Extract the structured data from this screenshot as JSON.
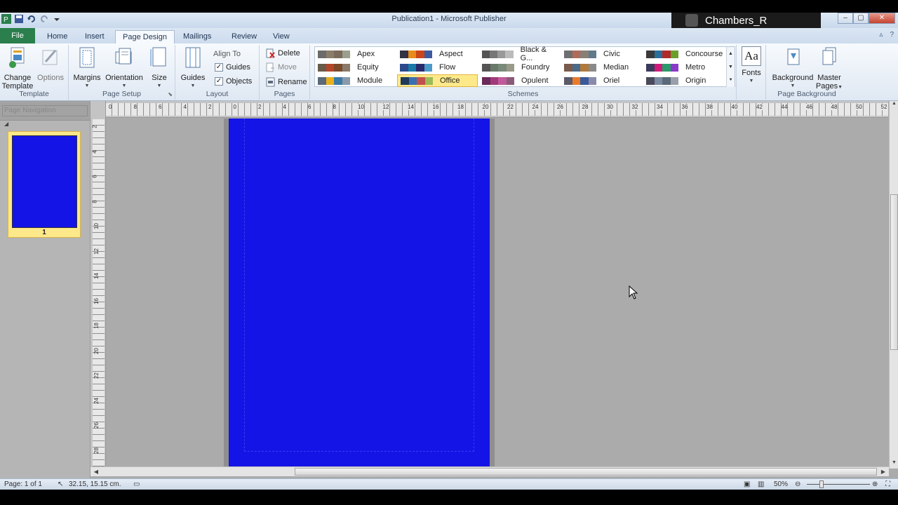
{
  "window": {
    "title": "Publication1 - Microsoft Publisher",
    "user": "Chambers_R"
  },
  "tabs": [
    {
      "label": "File"
    },
    {
      "label": "Home"
    },
    {
      "label": "Insert"
    },
    {
      "label": "Page Design"
    },
    {
      "label": "Mailings"
    },
    {
      "label": "Review"
    },
    {
      "label": "View"
    }
  ],
  "active_tab": "Page Design",
  "ribbon": {
    "template": {
      "group": "Template",
      "change_template": "Change Template",
      "change_template_l1": "Change",
      "change_template_l2": "Template",
      "options": "Options"
    },
    "page_setup": {
      "group": "Page Setup",
      "margins": "Margins",
      "orientation": "Orientation",
      "size": "Size"
    },
    "layout": {
      "group": "Layout",
      "guides": "Guides",
      "align_to": "Align To",
      "align_guides": "Guides",
      "align_objects": "Objects"
    },
    "pages": {
      "group": "Pages",
      "delete": "Delete",
      "move": "Move",
      "rename": "Rename"
    },
    "schemes": {
      "group": "Schemes",
      "items": [
        {
          "name": "Apex",
          "colors": [
            "#6b6b6b",
            "#8a7d6a",
            "#7a6b5a",
            "#9aa08b"
          ]
        },
        {
          "name": "Aspect",
          "colors": [
            "#333344",
            "#e88a1c",
            "#c9451c",
            "#3b5aa0"
          ]
        },
        {
          "name": "Black & G...",
          "colors": [
            "#555555",
            "#777777",
            "#999999",
            "#bbbbbb"
          ]
        },
        {
          "name": "Civic",
          "colors": [
            "#6f6f6f",
            "#b06a5a",
            "#8a7f75",
            "#5f7a8a"
          ]
        },
        {
          "name": "Concourse",
          "colors": [
            "#3a3a3a",
            "#2a6f9a",
            "#b02a2a",
            "#6aa02a"
          ]
        },
        {
          "name": "Equity",
          "colors": [
            "#6a5a4a",
            "#b5462a",
            "#7a4a2a",
            "#8a7a6a"
          ]
        },
        {
          "name": "Flow",
          "colors": [
            "#2a4a8a",
            "#1a7aa8",
            "#2a2a6a",
            "#4a9ac8"
          ]
        },
        {
          "name": "Foundry",
          "colors": [
            "#555555",
            "#6a7a6a",
            "#7a8a7a",
            "#9a9a8a"
          ]
        },
        {
          "name": "Median",
          "colors": [
            "#7a5a4a",
            "#4a6a8a",
            "#b07a3a",
            "#8a8a8a"
          ]
        },
        {
          "name": "Metro",
          "colors": [
            "#3a3a5a",
            "#d01a7a",
            "#2a9a6a",
            "#8a3ac8"
          ]
        },
        {
          "name": "Module",
          "colors": [
            "#5a6a7a",
            "#e8b01a",
            "#3a7aa8",
            "#8a9aaa"
          ]
        },
        {
          "name": "Office",
          "colors": [
            "#1f3a5a",
            "#3b6fb0",
            "#c0504d",
            "#9bbb59"
          ]
        },
        {
          "name": "Opulent",
          "colors": [
            "#6a2a5a",
            "#a03a7a",
            "#c05a9a",
            "#8a5a7a"
          ]
        },
        {
          "name": "Oriel",
          "colors": [
            "#5a5a6a",
            "#e87a2a",
            "#3a5a9a",
            "#8a8aaa"
          ]
        },
        {
          "name": "Origin",
          "colors": [
            "#4a4a5a",
            "#7a8aa0",
            "#5a6a7a",
            "#9aa0aa"
          ]
        }
      ],
      "selected": "Office"
    },
    "fonts": {
      "label": "Fonts",
      "icon_text": "Aa"
    },
    "page_background": {
      "group": "Page Background",
      "background": "Background",
      "master_pages": "Master Pages",
      "master_pages_l1": "Master",
      "master_pages_l2": "Pages"
    }
  },
  "pane": {
    "header": "Page Navigation",
    "thumb_label": "1",
    "thumb_color": "#1414e6"
  },
  "rulers": {
    "h_ticks": [
      "0",
      "8",
      "6",
      "4",
      "2",
      "0",
      "2",
      "4",
      "6",
      "8",
      "10",
      "12",
      "14",
      "16",
      "18",
      "20",
      "22",
      "24",
      "26",
      "28",
      "30",
      "32",
      "34",
      "36",
      "38",
      "40",
      "42",
      "44",
      "46",
      "48",
      "50",
      "52"
    ],
    "v_ticks": [
      "2",
      "4",
      "6",
      "8",
      "10",
      "12",
      "14",
      "16",
      "18",
      "20",
      "22",
      "24",
      "26",
      "28"
    ]
  },
  "page": {
    "color": "#1414e6"
  },
  "status": {
    "page": "Page: 1 of 1",
    "position": "32.15, 15.15 cm.",
    "zoom": "50%"
  }
}
